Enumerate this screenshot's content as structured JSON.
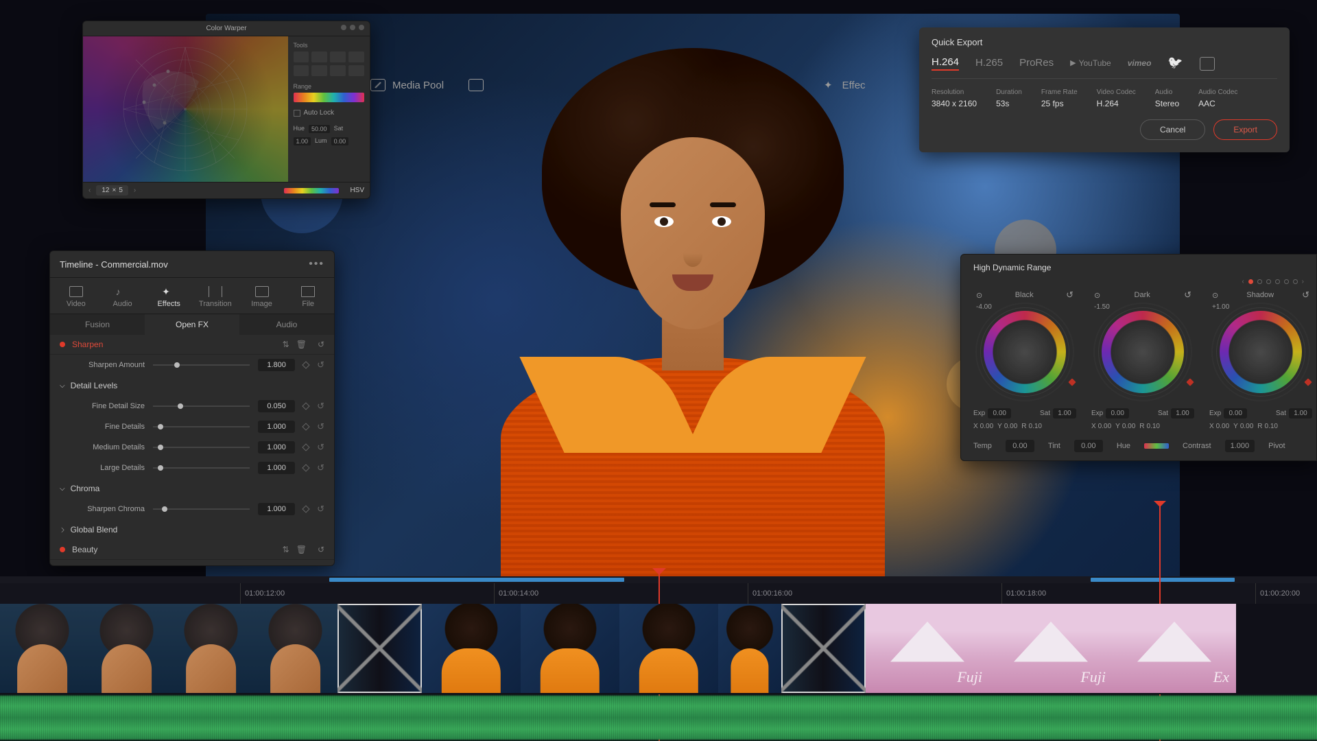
{
  "topToolbar": {
    "mediaPool": "Media Pool",
    "effects": "Effec"
  },
  "colorWarper": {
    "title": "Color Warper",
    "toolsLabel": "Tools",
    "rangeLabel": "Range",
    "autoLock": "Auto Lock",
    "hueLabel": "Hue",
    "hueVal": "50.00",
    "satLabel": "Sat",
    "satVal": "1.00",
    "lumLabel": "Lum",
    "lumVal": "0.00",
    "footLeft": "12",
    "footNext": "5",
    "footHsl": "HSV"
  },
  "fx": {
    "title": "Timeline - Commercial.mov",
    "tabs": [
      "Video",
      "Audio",
      "Effects",
      "Transition",
      "Image",
      "File"
    ],
    "subtabs": [
      "Fusion",
      "Open FX",
      "Audio"
    ],
    "sharpen": {
      "name": "Sharpen",
      "amountLabel": "Sharpen Amount",
      "amountVal": "1.800"
    },
    "detail": {
      "header": "Detail Levels",
      "fineSizeLabel": "Fine Detail Size",
      "fineSizeVal": "0.050",
      "fineLabel": "Fine Details",
      "fineVal": "1.000",
      "medLabel": "Medium Details",
      "medVal": "1.000",
      "largeLabel": "Large Details",
      "largeVal": "1.000"
    },
    "chroma": {
      "header": "Chroma",
      "label": "Sharpen Chroma",
      "val": "1.000"
    },
    "global": "Global Blend",
    "beauty": "Beauty"
  },
  "quickExport": {
    "title": "Quick Export",
    "tabs": [
      "H.264",
      "H.265",
      "ProRes"
    ],
    "svc": {
      "yt": "YouTube",
      "vimeo": "vimeo"
    },
    "cols": [
      {
        "l": "Resolution",
        "v": "3840 x 2160"
      },
      {
        "l": "Duration",
        "v": "53s"
      },
      {
        "l": "Frame Rate",
        "v": "25 fps"
      },
      {
        "l": "Video Codec",
        "v": "H.264"
      },
      {
        "l": "Audio",
        "v": "Stereo"
      },
      {
        "l": "Audio Codec",
        "v": "AAC"
      }
    ],
    "cancel": "Cancel",
    "export": "Export"
  },
  "hdr": {
    "title": "High Dynamic Range",
    "zones": [
      {
        "name": "Black",
        "off": "-4.00"
      },
      {
        "name": "Dark",
        "off": "-1.50"
      },
      {
        "name": "Shadow",
        "off": "+1.00"
      }
    ],
    "row": {
      "exp": "Exp",
      "expV": "0.00",
      "sat": "Sat",
      "satV": "1.00"
    },
    "xyz": {
      "x": "X",
      "xv": "0.00",
      "y": "Y",
      "yv": "0.00",
      "r": "R",
      "rv": "0.10"
    },
    "bottom": {
      "temp": "Temp",
      "tempV": "0.00",
      "tint": "Tint",
      "tintV": "0.00",
      "hue": "Hue",
      "contrast": "Contrast",
      "contrastV": "1.000",
      "pivot": "Pivot"
    }
  },
  "timeline": {
    "ticks": [
      "01:00:12:00",
      "01:00:14:00",
      "01:00:16:00",
      "01:00:18:00",
      "01:00:20:00"
    ],
    "fuji": "Fuji",
    "fujiEx": "Ex"
  }
}
